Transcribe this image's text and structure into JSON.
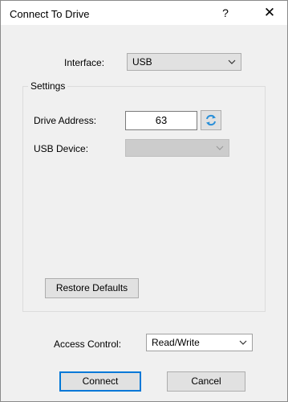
{
  "window": {
    "title": "Connect To Drive",
    "help_glyph": "?",
    "close_glyph": "✕"
  },
  "interface": {
    "label": "Interface:",
    "value": "USB"
  },
  "settings": {
    "group_title": "Settings",
    "drive_address_label": "Drive Address:",
    "drive_address_value": "63",
    "usb_device_label": "USB Device:",
    "usb_device_value": "",
    "restore_defaults_label": "Restore Defaults"
  },
  "access_control": {
    "label": "Access Control:",
    "value": "Read/Write"
  },
  "actions": {
    "connect_label": "Connect",
    "cancel_label": "Cancel"
  },
  "colors": {
    "accent": "#0078d7",
    "refresh_icon": "#2a8fd8"
  },
  "icons": {
    "refresh": "refresh-icon",
    "dropdown": "chevron-down-icon"
  }
}
